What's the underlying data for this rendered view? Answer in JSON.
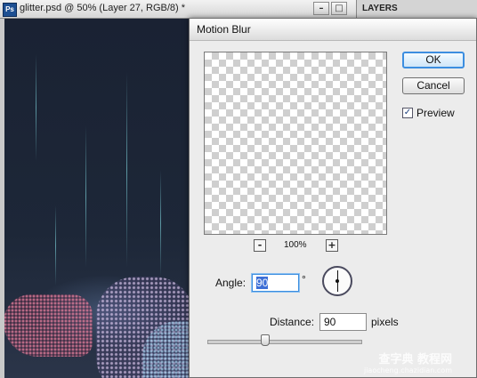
{
  "document": {
    "ps_badge": "Ps",
    "title": "glitter.psd @ 50% (Layer 27, RGB/8) *",
    "window_buttons": [
      "–",
      "□"
    ],
    "layers_tab": "LAYERS"
  },
  "dialog": {
    "title": "Motion Blur",
    "ok_label": "OK",
    "cancel_label": "Cancel",
    "preview_checked": true,
    "preview_label": "Preview",
    "zoom_out": "-",
    "zoom_in": "+",
    "zoom_level": "100%",
    "angle_label": "Angle:",
    "angle_value": "90",
    "angle_unit": "°",
    "distance_label": "Distance:",
    "distance_value": "90",
    "distance_unit": "pixels",
    "checkbox_mark": "✓"
  },
  "watermark": {
    "text": "查字典 教程网",
    "url": "jiaocheng.chazidian.com"
  }
}
